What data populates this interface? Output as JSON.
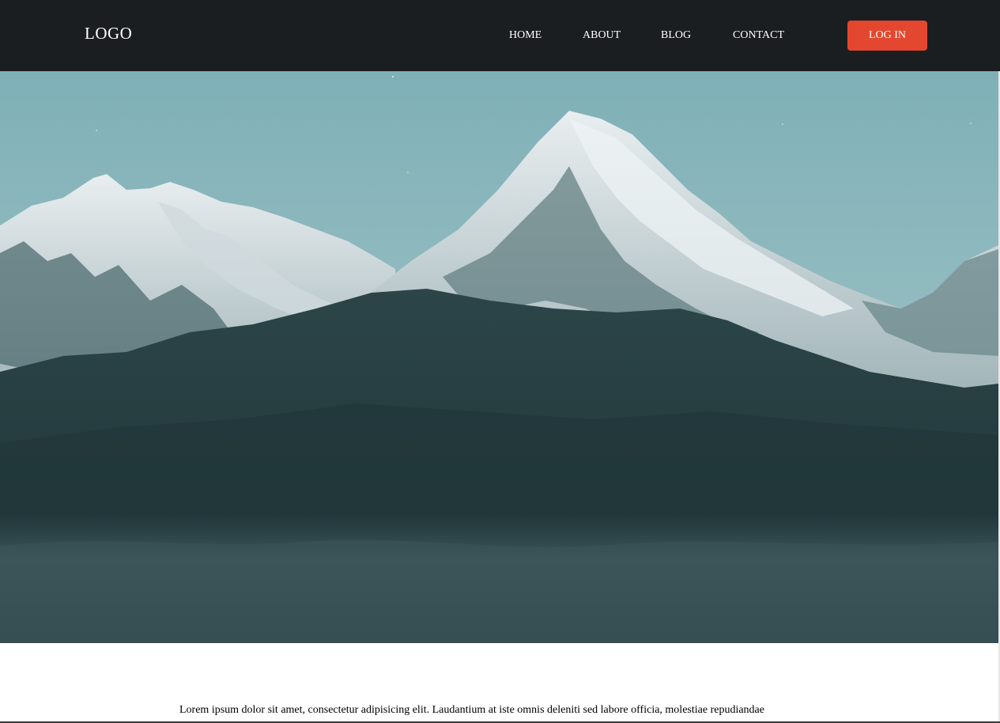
{
  "header": {
    "logo": "LOGO",
    "nav": [
      {
        "label": "HOME"
      },
      {
        "label": "ABOUT"
      },
      {
        "label": "BLOG"
      },
      {
        "label": "CONTACT"
      }
    ],
    "login_label": "LOG IN"
  },
  "hero": {
    "image": "snow-capped-mountains-photo"
  },
  "content": {
    "paragraph": "Lorem ipsum dolor sit amet, consectetur adipisicing elit. Laudantium at iste omnis deleniti sed labore officia, molestiae repudiandae"
  },
  "colors": {
    "navbar": "#1b1e20",
    "login_button": "#e4472f",
    "sky": "#8fbcc2",
    "mountain_dark": "#1f3a3e"
  }
}
